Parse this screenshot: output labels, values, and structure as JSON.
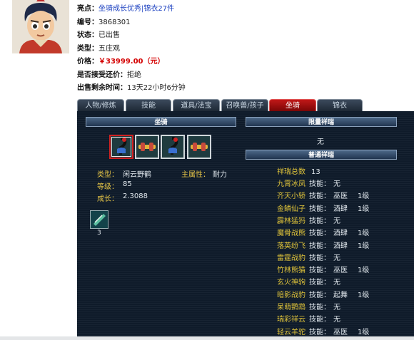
{
  "listing": {
    "highlight_label": "亮点：",
    "highlight_value": "坐骑成长优秀|锦衣27件",
    "id_label": "编号：",
    "id_value": "3868301",
    "status_label": "状态：",
    "status_value": "已出售",
    "type_label": "类型：",
    "type_value": "五庄观",
    "price_label": "价格：",
    "price_value": "￥33999.00（元）",
    "counter_label": "是否接受还价：",
    "counter_value": "拒绝",
    "remain_label": "出售剩余时间：",
    "remain_value": "13天22小时6分钟"
  },
  "tabs": [
    "人物/修炼",
    "技能",
    "道具/法宝",
    "召唤兽/孩子",
    "坐骑",
    "锦衣"
  ],
  "active_tab": "坐骑",
  "mount": {
    "header": "坐骑",
    "type_label": "类型：",
    "type_value": "闲云野鹤",
    "main_attr_label": "主属性：",
    "main_attr_value": "耐力",
    "level_label": "等级：",
    "level_value": "85",
    "growth_label": "成长：",
    "growth_value": "2.3088",
    "skill_count": "3"
  },
  "rare_fortune": {
    "header": "限量祥瑞",
    "value": "无"
  },
  "normal_fortune": {
    "header": "普通祥瑞",
    "total_label": "祥瑞总数",
    "total_value": "13",
    "items": [
      {
        "name": "九霄冰凤",
        "skill_label": "技能：",
        "skill": "无",
        "level": ""
      },
      {
        "name": "齐天小轿",
        "skill_label": "技能：",
        "skill": "巫医",
        "level": "1级"
      },
      {
        "name": "金鳞仙子",
        "skill_label": "技能：",
        "skill": "酒肆",
        "level": "1级"
      },
      {
        "name": "霹林猛犸",
        "skill_label": "技能：",
        "skill": "无",
        "level": ""
      },
      {
        "name": "魔骨战熊",
        "skill_label": "技能：",
        "skill": "酒肆",
        "level": "1级"
      },
      {
        "name": "落英纷飞",
        "skill_label": "技能：",
        "skill": "酒肆",
        "level": "1级"
      },
      {
        "name": "雷霆战豹",
        "skill_label": "技能：",
        "skill": "无",
        "level": ""
      },
      {
        "name": "竹林熊猫",
        "skill_label": "技能：",
        "skill": "巫医",
        "level": "1级"
      },
      {
        "name": "玄火神驹",
        "skill_label": "技能：",
        "skill": "无",
        "level": ""
      },
      {
        "name": "暗影战豹",
        "skill_label": "技能：",
        "skill": "起舞",
        "level": "1级"
      },
      {
        "name": "呆萌鹦鹉",
        "skill_label": "技能：",
        "skill": "无",
        "level": ""
      },
      {
        "name": "瑞彩祥云",
        "skill_label": "技能：",
        "skill": "无",
        "level": ""
      },
      {
        "name": "轻云羊驼",
        "skill_label": "技能：",
        "skill": "巫医",
        "level": "1级"
      }
    ]
  }
}
